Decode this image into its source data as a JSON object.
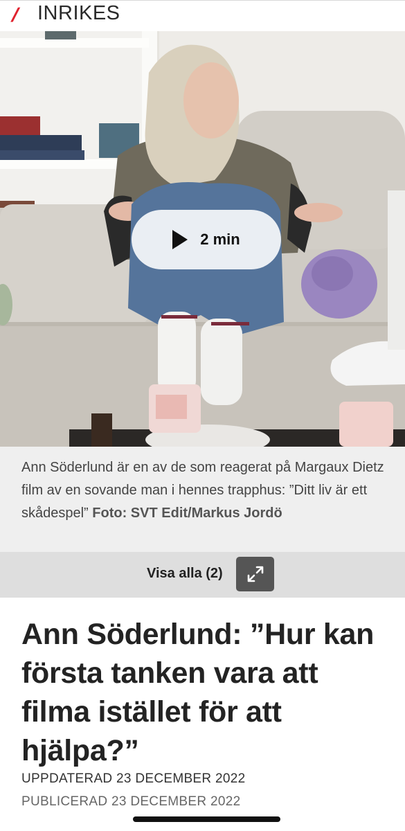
{
  "section": {
    "title": "INRIKES",
    "slash": "/",
    "accent_color": "#e0222e"
  },
  "media": {
    "play_label": "2 min",
    "play_icon": "play-icon",
    "caption_text": "Ann Söderlund är en av de som reagerat på Margaux Dietz film av en sovande man i hennes trapphus: ”Ditt liv är ett skådespel”",
    "caption_credit": "Foto: SVT Edit/Markus Jordö",
    "visa_alla_label": "Visa alla (2)",
    "expand_icon": "expand-icon"
  },
  "article": {
    "headline": "Ann Söderlund: ”Hur kan första tanken vara att filma istället för att hjälpa?”",
    "updated": "UPPDATERAD 23 DECEMBER 2022",
    "published": "PUBLICERAD 23 DECEMBER 2022"
  }
}
